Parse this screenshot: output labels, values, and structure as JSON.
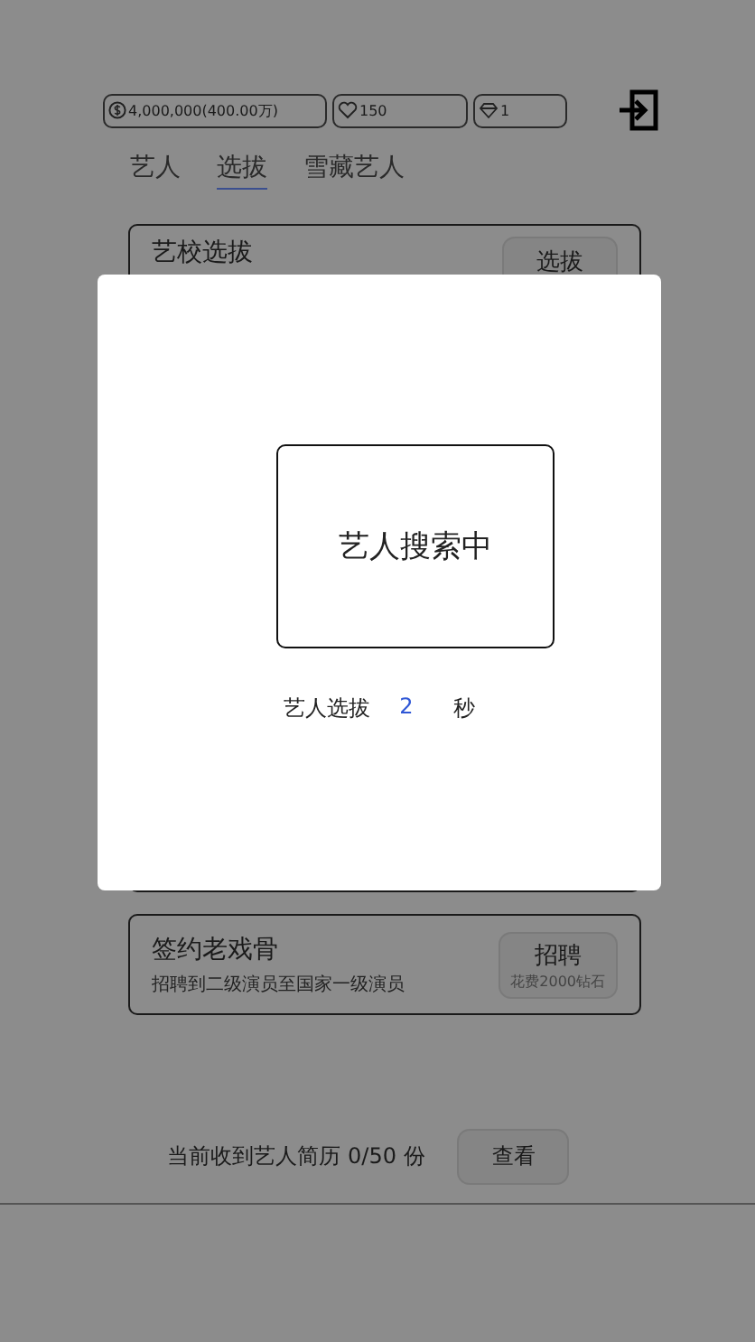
{
  "stats": [
    {
      "kind": "money",
      "value": "4,000,000(400.00万)"
    },
    {
      "kind": "heart",
      "value": "150"
    },
    {
      "kind": "diamond",
      "value": "1"
    }
  ],
  "tabs": [
    {
      "label": "艺人",
      "selected": false
    },
    {
      "label": "选拔",
      "selected": true
    },
    {
      "label": "雪藏艺人",
      "selected": false
    }
  ],
  "cards_top": [
    {
      "title": "艺校选拔",
      "button": "选拔"
    }
  ],
  "card_bottom": {
    "title": "签约老戏骨",
    "subtitle": "招聘到二级演员至国家一级演员",
    "button": "招聘",
    "button_note": "花费2000钻石"
  },
  "footer": {
    "text": "当前收到艺人简历 0/50 份",
    "button": "查看"
  },
  "modal": {
    "box_text": "艺人搜索中",
    "label": "艺人选拔",
    "count": "2",
    "unit": "秒"
  }
}
